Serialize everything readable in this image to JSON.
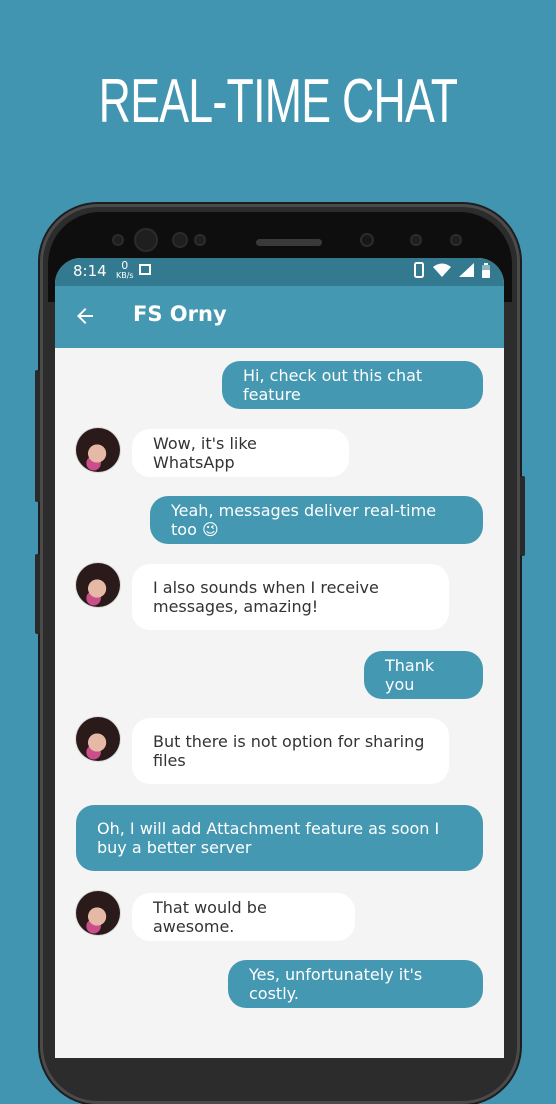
{
  "headline": "REAL-TIME CHAT",
  "status_bar": {
    "time": "8:14",
    "kbs_value": "0",
    "kbs_unit": "KB/s"
  },
  "app_bar": {
    "title": "FS Orny"
  },
  "colors": {
    "background": "#4295b0",
    "accent": "#4498b2",
    "status_bar": "#33798f"
  },
  "messages": [
    {
      "direction": "sent",
      "text": "Hi, check out this chat feature"
    },
    {
      "direction": "received",
      "text": "Wow, it's like WhatsApp"
    },
    {
      "direction": "sent",
      "text": "Yeah, messages deliver real-time too 😉"
    },
    {
      "direction": "received",
      "text": "I also sounds when I receive messages, amazing!"
    },
    {
      "direction": "sent",
      "text": "Thank you"
    },
    {
      "direction": "received",
      "text": "But there is not option for sharing files"
    },
    {
      "direction": "sent",
      "text": "Oh, I will add Attachment feature as soon I buy a better server"
    },
    {
      "direction": "received",
      "text": "That would be awesome."
    },
    {
      "direction": "sent",
      "text": "Yes, unfortunately it's costly."
    }
  ]
}
